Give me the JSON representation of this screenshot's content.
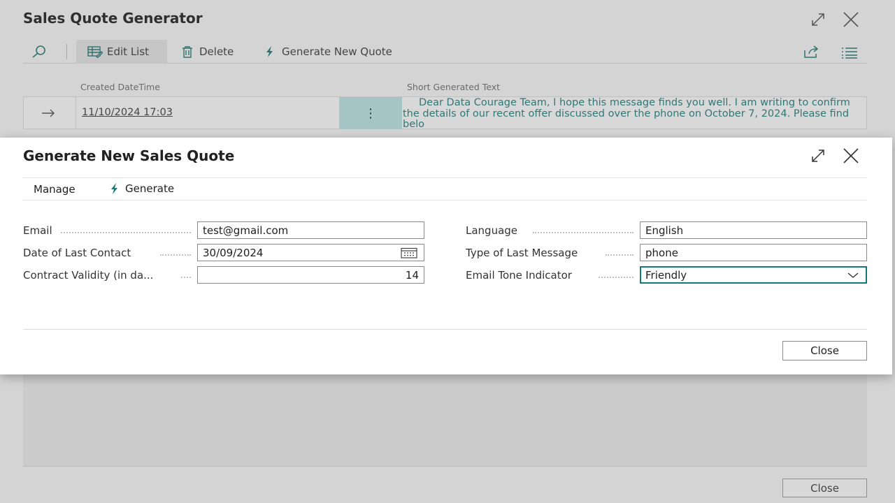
{
  "page": {
    "title": "Sales Quote Generator",
    "actions": {
      "edit_list": "Edit List",
      "delete": "Delete",
      "generate_new_quote": "Generate New Quote"
    },
    "columns": {
      "created": "Created DateTime",
      "short_text": "Short Generated Text"
    },
    "rows": [
      {
        "created": "11/10/2024 17:03",
        "menu": "⋮",
        "short_text": "Dear Data Courage Team,    I hope this message finds you well. I am writing to confirm the details of our recent offer discussed over the phone on October 7, 2024. Please find belo"
      }
    ],
    "close_label": "Close"
  },
  "dialog": {
    "title": "Generate New Sales Quote",
    "actions": {
      "manage": "Manage",
      "generate": "Generate"
    },
    "fields": {
      "email": {
        "label": "Email",
        "value": "test@gmail.com"
      },
      "date_last_contact": {
        "label": "Date of Last Contact",
        "value": "30/09/2024"
      },
      "contract_validity": {
        "label": "Contract Validity (in da...",
        "value": "14"
      },
      "language": {
        "label": "Language",
        "value": "English"
      },
      "type_last_message": {
        "label": "Type of Last Message",
        "value": "phone"
      },
      "email_tone": {
        "label": "Email Tone Indicator",
        "value": "Friendly"
      }
    },
    "close_label": "Close"
  },
  "icons": {
    "search": "search-icon",
    "edit_list": "edit-list-icon",
    "delete": "trash-icon",
    "generate": "lightning-icon",
    "share": "share-icon",
    "list_view": "list-icon",
    "expand": "expand-icon",
    "close": "close-icon",
    "calendar": "calendar-icon",
    "dropdown": "chevron-down-icon",
    "row_arrow": "arrow-right-icon"
  },
  "colors": {
    "accent": "#137a78",
    "background_overlay": "#d4d4d4",
    "dialog_bg": "#ffffff"
  }
}
